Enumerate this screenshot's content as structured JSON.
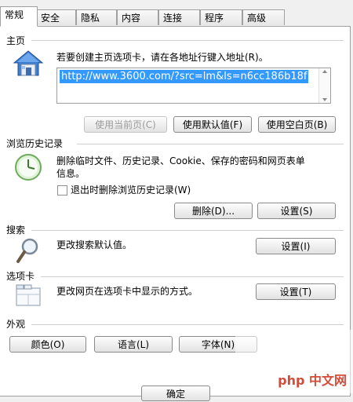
{
  "tabs": [
    {
      "label": "常规",
      "active": true
    },
    {
      "label": "安全"
    },
    {
      "label": "隐私"
    },
    {
      "label": "内容"
    },
    {
      "label": "连接"
    },
    {
      "label": "程序"
    },
    {
      "label": "高级"
    }
  ],
  "homepage": {
    "title": "主页",
    "instructions": "若要创建主页选项卡，请在各地址行键入地址(R)。",
    "url": "http://www.3600.com/?src=lm&ls=n6cc186b18f",
    "btn_current": "使用当前页(C)",
    "btn_default": "使用默认值(F)",
    "btn_blank": "使用空白页(B)"
  },
  "history": {
    "title": "浏览历史记录",
    "desc_line1": "删除临时文件、历史记录、Cookie、保存的密码和网页表单",
    "desc_line2": "信息。",
    "checkbox_label": "退出时删除浏览历史记录(W)",
    "btn_delete": "删除(D)...",
    "btn_settings": "设置(S)"
  },
  "search": {
    "title": "搜索",
    "desc": "更改搜索默认值。",
    "btn_settings": "设置(I)"
  },
  "tabs_section": {
    "title": "选项卡",
    "desc": "更改网页在选项卡中显示的方式。",
    "btn_settings": "设置(T)"
  },
  "appearance": {
    "title": "外观",
    "btn_colors": "颜色(O)",
    "btn_languages": "语言(L)",
    "btn_fonts": "字体(N)"
  },
  "footer": {
    "btn_ok": "确定"
  },
  "watermark": {
    "text": "php 中文网"
  }
}
